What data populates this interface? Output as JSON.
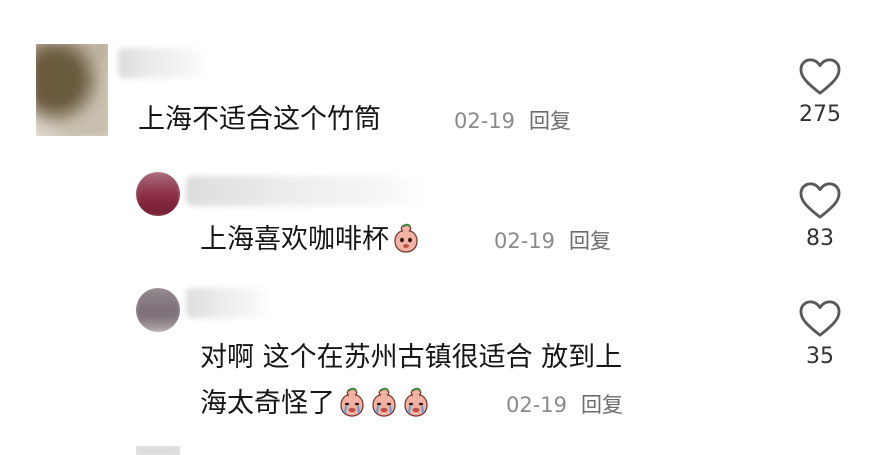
{
  "comments": [
    {
      "text": "上海不适合这个竹筒",
      "date": "02-19",
      "reply_label": "回复",
      "likes": "275"
    },
    {
      "text": "上海喜欢咖啡杯",
      "emoji": "crying-peach-emoji",
      "date": "02-19",
      "reply_label": "回复",
      "likes": "83"
    },
    {
      "text_line1": "对啊 这个在苏州古镇很适合 放到上",
      "text_line2": "海太奇怪了",
      "emoji": "crying-peach-emoji",
      "date": "02-19",
      "reply_label": "回复",
      "likes": "35"
    }
  ],
  "icons": {
    "like": "heart-outline-icon"
  },
  "colors": {
    "text": "#161616",
    "meta": "#8a8a8a",
    "heart_stroke": "#5a5a5a"
  }
}
